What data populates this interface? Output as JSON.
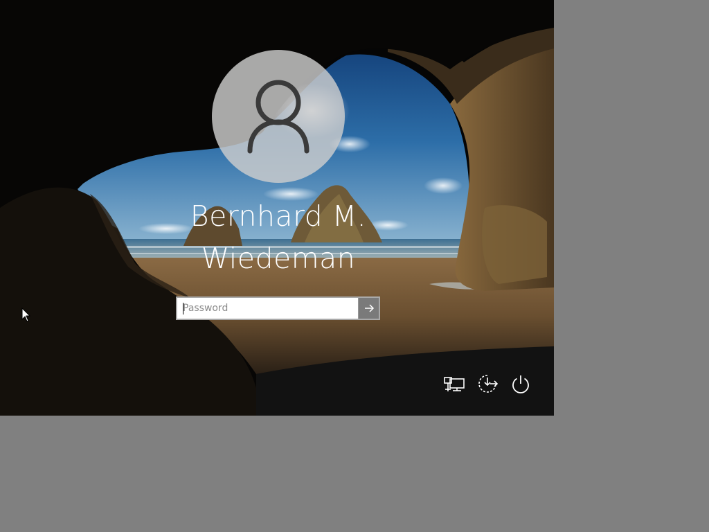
{
  "login": {
    "username": "Bernhard M.\nWiedeman",
    "password_placeholder": "Password",
    "password_value": ""
  },
  "icons": {
    "avatar": "user-silhouette-icon",
    "submit": "arrow-right-icon",
    "network": "network-icon",
    "ease_of_access": "ease-of-access-icon",
    "power": "power-icon",
    "cursor": "mouse-pointer-icon"
  },
  "colors": {
    "text": "#ffffff",
    "avatar_bg": "#cdcdcd",
    "submit_bg": "#7a7a7a",
    "outside_bg": "#808080"
  }
}
